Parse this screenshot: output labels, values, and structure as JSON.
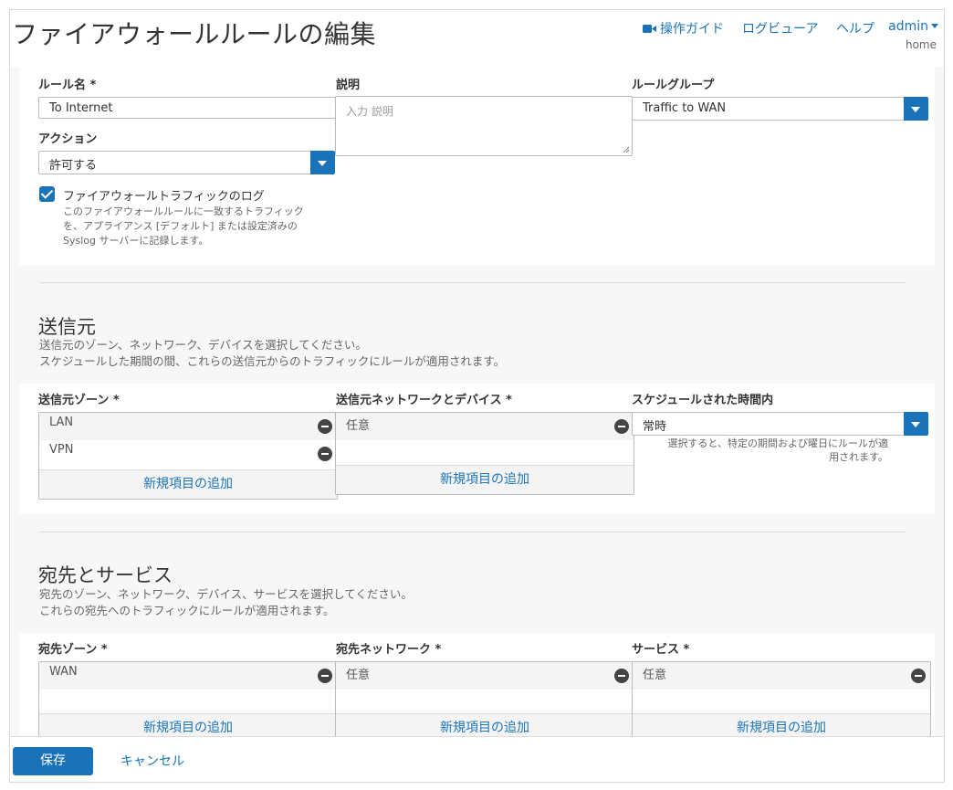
{
  "header": {
    "title": "ファイアウォールルールの編集",
    "links": {
      "guide": "操作ガイド",
      "log_viewer": "ログビューア",
      "help": "ヘルプ"
    },
    "user": {
      "name": "admin",
      "domain": "home"
    }
  },
  "rule": {
    "name_label": "ルール名 *",
    "name_value": "To Internet",
    "desc_label": "説明",
    "desc_placeholder": "入力 説明",
    "group_label": "ルールグループ",
    "group_value": "Traffic to WAN",
    "action_label": "アクション",
    "action_value": "許可する",
    "log": {
      "checked": true,
      "title": "ファイアウォールトラフィックのログ",
      "description": "このファイアウォールルールに一致するトラフィックを、アプライアンス [デフォルト] または設定済みの Syslog サーバーに記録します。"
    }
  },
  "source": {
    "title": "送信元",
    "desc1": "送信元のゾーン、ネットワーク、デバイスを選択してください。",
    "desc2": "スケジュールした期間の間、これらの送信元からのトラフィックにルールが適用されます。",
    "zones_label": "送信元ゾーン *",
    "zones": [
      "LAN",
      "VPN"
    ],
    "networks_label": "送信元ネットワークとデバイス *",
    "networks": [
      "任意"
    ],
    "schedule_label": "スケジュールされた時間内",
    "schedule_value": "常時",
    "schedule_hint": "選択すると、特定の期間および曜日にルールが適用されます。",
    "add_label": "新規項目の追加"
  },
  "destination": {
    "title": "宛先とサービス",
    "desc1": "宛先のゾーン、ネットワーク、デバイス、サービスを選択してください。",
    "desc2": "これらの宛先へのトラフィックにルールが適用されます。",
    "zones_label": "宛先ゾーン *",
    "zones": [
      "WAN"
    ],
    "networks_label": "宛先ネットワーク *",
    "networks": [
      "任意"
    ],
    "services_label": "サービス *",
    "services": [
      "任意"
    ],
    "add_label": "新規項目の追加"
  },
  "footer": {
    "save": "保存",
    "cancel": "キャンセル"
  },
  "colors": {
    "accent": "#1a73b8",
    "background": "#f7f7f7"
  }
}
